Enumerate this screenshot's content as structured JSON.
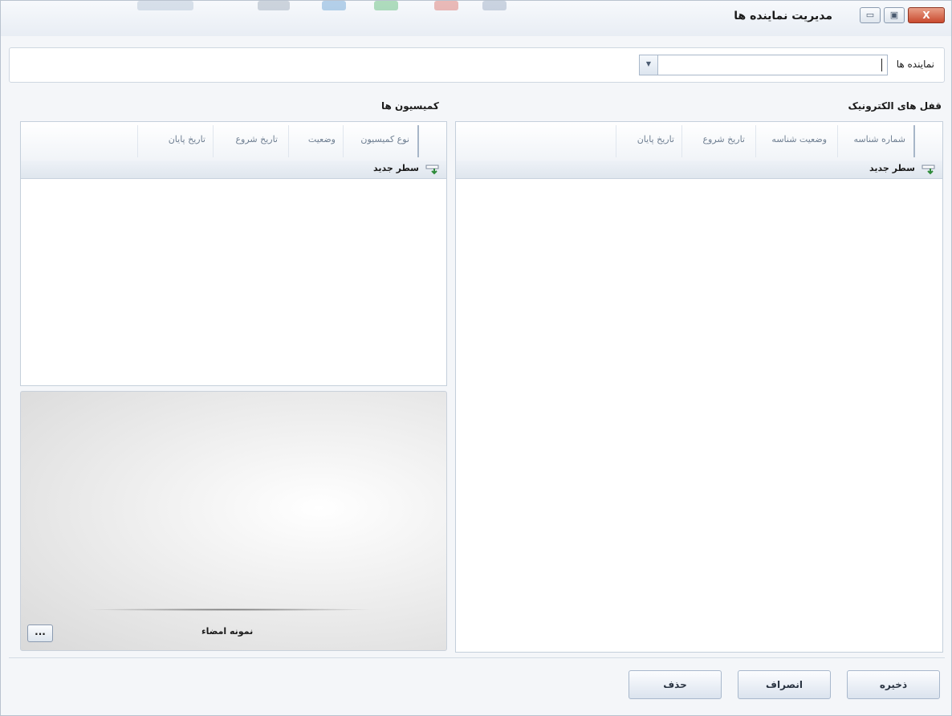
{
  "window": {
    "title": "مدیریت نماینده ها",
    "min_glyph": "▭",
    "max_glyph": "▣",
    "close_glyph": "X"
  },
  "agents_field": {
    "label": "نماینده ها",
    "value": "",
    "arrow_glyph": "▼"
  },
  "locks": {
    "title": "قفل های الکترونیک",
    "columns": [
      "شماره شناسه",
      "وضعیت شناسه",
      "تاریخ شروع",
      "تاریخ پایان"
    ],
    "new_row_label": "سطر جدید",
    "rows": []
  },
  "commissions": {
    "title": "کمیسیون ها",
    "columns": [
      "نوع کمیسیون",
      "وضعیت",
      "تاریخ شروع",
      "تاریخ پایان"
    ],
    "new_row_label": "سطر جدید",
    "rows": []
  },
  "signature": {
    "label": "نمونه امضاء",
    "browse_label": "..."
  },
  "buttons": {
    "save": "ذخیره",
    "cancel": "انصراف",
    "delete": "حذف"
  },
  "icons": {
    "new_row": "new-row-icon"
  },
  "colors": {
    "accent_close": "#c94a2f",
    "new_row_arrow": "#2e8b3a"
  }
}
